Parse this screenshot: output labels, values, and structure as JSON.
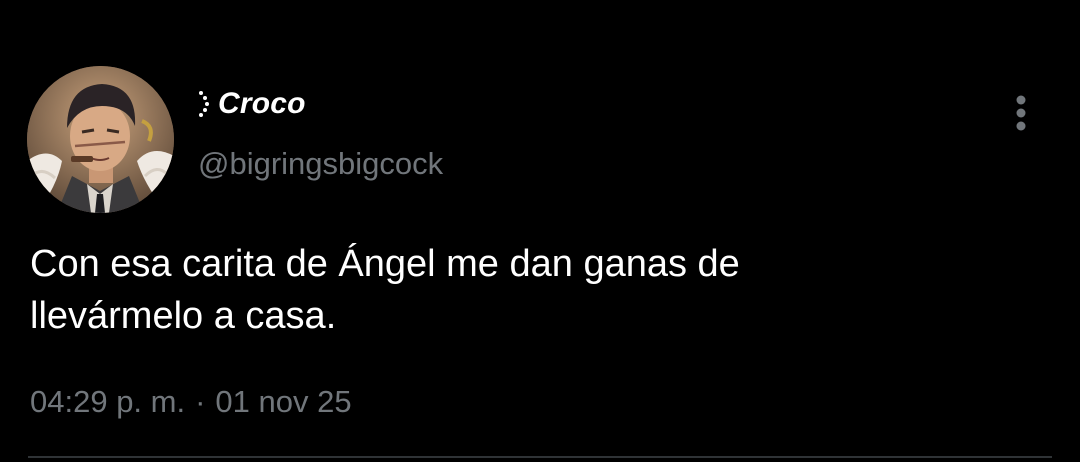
{
  "tweet": {
    "author": {
      "display_name": "Croco",
      "handle": "@bigringsbigcock",
      "avatar_icon": "anime-character-avatar",
      "name_prefix_icon": "dotted-bracket-icon"
    },
    "text": "Con esa carita de Ángel me dan ganas de\nllevármelo a casa.",
    "time": "04:29 p. m.",
    "separator": "·",
    "date": "01 nov 25",
    "more_icon": "more-vertical-icon"
  },
  "colors": {
    "background": "#000000",
    "primary_text": "#ffffff",
    "secondary_text": "#71767b",
    "divider": "#2f3336"
  }
}
